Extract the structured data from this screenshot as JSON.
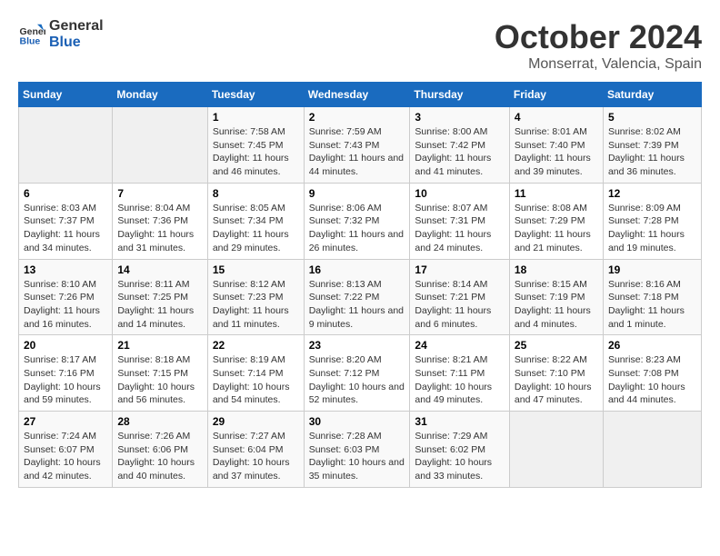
{
  "header": {
    "logo_line1": "General",
    "logo_line2": "Blue",
    "month": "October 2024",
    "location": "Monserrat, Valencia, Spain"
  },
  "days_of_week": [
    "Sunday",
    "Monday",
    "Tuesday",
    "Wednesday",
    "Thursday",
    "Friday",
    "Saturday"
  ],
  "weeks": [
    [
      {
        "day": "",
        "info": ""
      },
      {
        "day": "",
        "info": ""
      },
      {
        "day": "1",
        "info": "Sunrise: 7:58 AM\nSunset: 7:45 PM\nDaylight: 11 hours and 46 minutes."
      },
      {
        "day": "2",
        "info": "Sunrise: 7:59 AM\nSunset: 7:43 PM\nDaylight: 11 hours and 44 minutes."
      },
      {
        "day": "3",
        "info": "Sunrise: 8:00 AM\nSunset: 7:42 PM\nDaylight: 11 hours and 41 minutes."
      },
      {
        "day": "4",
        "info": "Sunrise: 8:01 AM\nSunset: 7:40 PM\nDaylight: 11 hours and 39 minutes."
      },
      {
        "day": "5",
        "info": "Sunrise: 8:02 AM\nSunset: 7:39 PM\nDaylight: 11 hours and 36 minutes."
      }
    ],
    [
      {
        "day": "6",
        "info": "Sunrise: 8:03 AM\nSunset: 7:37 PM\nDaylight: 11 hours and 34 minutes."
      },
      {
        "day": "7",
        "info": "Sunrise: 8:04 AM\nSunset: 7:36 PM\nDaylight: 11 hours and 31 minutes."
      },
      {
        "day": "8",
        "info": "Sunrise: 8:05 AM\nSunset: 7:34 PM\nDaylight: 11 hours and 29 minutes."
      },
      {
        "day": "9",
        "info": "Sunrise: 8:06 AM\nSunset: 7:32 PM\nDaylight: 11 hours and 26 minutes."
      },
      {
        "day": "10",
        "info": "Sunrise: 8:07 AM\nSunset: 7:31 PM\nDaylight: 11 hours and 24 minutes."
      },
      {
        "day": "11",
        "info": "Sunrise: 8:08 AM\nSunset: 7:29 PM\nDaylight: 11 hours and 21 minutes."
      },
      {
        "day": "12",
        "info": "Sunrise: 8:09 AM\nSunset: 7:28 PM\nDaylight: 11 hours and 19 minutes."
      }
    ],
    [
      {
        "day": "13",
        "info": "Sunrise: 8:10 AM\nSunset: 7:26 PM\nDaylight: 11 hours and 16 minutes."
      },
      {
        "day": "14",
        "info": "Sunrise: 8:11 AM\nSunset: 7:25 PM\nDaylight: 11 hours and 14 minutes."
      },
      {
        "day": "15",
        "info": "Sunrise: 8:12 AM\nSunset: 7:23 PM\nDaylight: 11 hours and 11 minutes."
      },
      {
        "day": "16",
        "info": "Sunrise: 8:13 AM\nSunset: 7:22 PM\nDaylight: 11 hours and 9 minutes."
      },
      {
        "day": "17",
        "info": "Sunrise: 8:14 AM\nSunset: 7:21 PM\nDaylight: 11 hours and 6 minutes."
      },
      {
        "day": "18",
        "info": "Sunrise: 8:15 AM\nSunset: 7:19 PM\nDaylight: 11 hours and 4 minutes."
      },
      {
        "day": "19",
        "info": "Sunrise: 8:16 AM\nSunset: 7:18 PM\nDaylight: 11 hours and 1 minute."
      }
    ],
    [
      {
        "day": "20",
        "info": "Sunrise: 8:17 AM\nSunset: 7:16 PM\nDaylight: 10 hours and 59 minutes."
      },
      {
        "day": "21",
        "info": "Sunrise: 8:18 AM\nSunset: 7:15 PM\nDaylight: 10 hours and 56 minutes."
      },
      {
        "day": "22",
        "info": "Sunrise: 8:19 AM\nSunset: 7:14 PM\nDaylight: 10 hours and 54 minutes."
      },
      {
        "day": "23",
        "info": "Sunrise: 8:20 AM\nSunset: 7:12 PM\nDaylight: 10 hours and 52 minutes."
      },
      {
        "day": "24",
        "info": "Sunrise: 8:21 AM\nSunset: 7:11 PM\nDaylight: 10 hours and 49 minutes."
      },
      {
        "day": "25",
        "info": "Sunrise: 8:22 AM\nSunset: 7:10 PM\nDaylight: 10 hours and 47 minutes."
      },
      {
        "day": "26",
        "info": "Sunrise: 8:23 AM\nSunset: 7:08 PM\nDaylight: 10 hours and 44 minutes."
      }
    ],
    [
      {
        "day": "27",
        "info": "Sunrise: 7:24 AM\nSunset: 6:07 PM\nDaylight: 10 hours and 42 minutes."
      },
      {
        "day": "28",
        "info": "Sunrise: 7:26 AM\nSunset: 6:06 PM\nDaylight: 10 hours and 40 minutes."
      },
      {
        "day": "29",
        "info": "Sunrise: 7:27 AM\nSunset: 6:04 PM\nDaylight: 10 hours and 37 minutes."
      },
      {
        "day": "30",
        "info": "Sunrise: 7:28 AM\nSunset: 6:03 PM\nDaylight: 10 hours and 35 minutes."
      },
      {
        "day": "31",
        "info": "Sunrise: 7:29 AM\nSunset: 6:02 PM\nDaylight: 10 hours and 33 minutes."
      },
      {
        "day": "",
        "info": ""
      },
      {
        "day": "",
        "info": ""
      }
    ]
  ]
}
